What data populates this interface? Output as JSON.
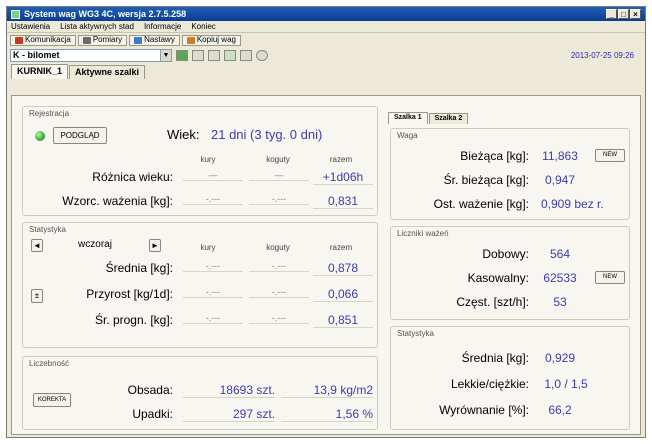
{
  "window": {
    "title": "System wag WG3 4C, wersja 2.7.5.258",
    "btn_min": "_",
    "btn_max": "□",
    "btn_close": "×"
  },
  "menu": [
    "Ustawienia",
    "Lista aktywnych stad",
    "Informacje",
    "Koniec"
  ],
  "toolbar": [
    "Komunikacja",
    "Pomiary",
    "Nastawy",
    "Kopiuj wag"
  ],
  "selector": {
    "value": "K - bilomet",
    "arrow": "▼"
  },
  "datetime": "2013-07-25 09:26",
  "top_tabs": [
    "KURNIK_1",
    "Aktywne szalki"
  ],
  "right_tabs": [
    "Szalka 1",
    "Szalka 2"
  ],
  "registration": {
    "group_label": "Rejestracja",
    "button": "PODGLĄD",
    "age_label": "Wiek:",
    "age_value": "21 dni (3 tyg. 0 dni)",
    "headers": [
      "kury",
      "koguty",
      "razem"
    ],
    "rows": [
      {
        "label": "Różnica wieku:",
        "kury": "—",
        "koguty": "—",
        "razem": "+1d06h"
      },
      {
        "label": "Wzorc. ważenia [kg]:",
        "kury": "-.---",
        "koguty": "-.---",
        "razem": "0,831"
      }
    ]
  },
  "statistics": {
    "group_label": "Statystyka",
    "prev": "◄",
    "day": "wczoraj",
    "next": "►",
    "headers": [
      "kury",
      "koguty",
      "razem"
    ],
    "rows": [
      {
        "label": "Średnia [kg]:",
        "kury": "-.---",
        "koguty": "-.---",
        "razem": "0,878"
      },
      {
        "label": "Przyrost [kg/1d]:",
        "kury": "-.---",
        "koguty": "-.---",
        "razem": "0,066"
      },
      {
        "label": "Śr. progn. [kg]:",
        "kury": "-.---",
        "koguty": "-.---",
        "razem": "0,851"
      }
    ],
    "spinner": "±"
  },
  "count": {
    "group_label": "Liczebność",
    "button": "KOREKTA",
    "rows": [
      {
        "label": "Obsada:",
        "v1": "18693 szt.",
        "v2": "13,9 kg/m2"
      },
      {
        "label": "Upadki:",
        "v1": "297 szt.",
        "v2": "1,56 %"
      }
    ]
  },
  "weight": {
    "group_label": "Waga",
    "rows": [
      {
        "label": "Bieżąca [kg]:",
        "value": "11,863",
        "btn": "NEW"
      },
      {
        "label": "Śr. bieżąca [kg]:",
        "value": "0,947"
      },
      {
        "label": "Ost. ważenie [kg]:",
        "value": "0,909 bez r."
      }
    ]
  },
  "counters": {
    "group_label": "Liczniki ważeń",
    "rows": [
      {
        "label": "Dobowy:",
        "value": "564"
      },
      {
        "label": "Kasowalny:",
        "value": "62533",
        "btn": "NEW"
      },
      {
        "label": "Częst. [szt/h]:",
        "value": "53"
      }
    ]
  },
  "right_stats": {
    "group_label": "Statystyka",
    "rows": [
      {
        "label": "Średnia [kg]:",
        "value": "0,929"
      },
      {
        "label": "Lekkie/ciężkie:",
        "value": "1,0 / 1,5"
      },
      {
        "label": "Wyrównanie [%]:",
        "value": "66,2"
      }
    ]
  }
}
